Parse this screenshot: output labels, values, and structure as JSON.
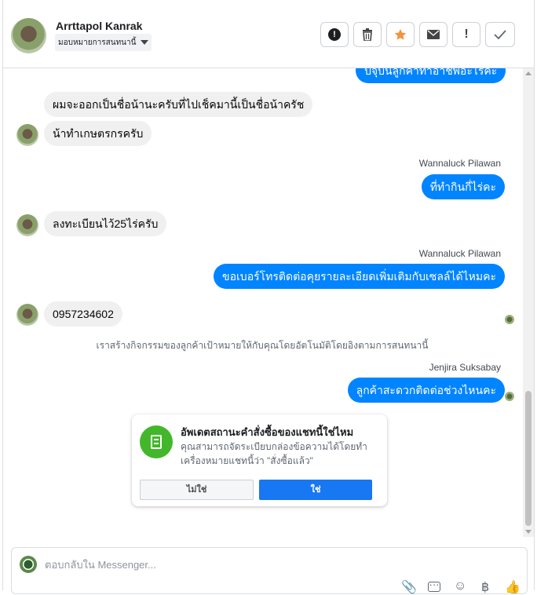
{
  "header": {
    "contact_name": "Arrttapol Kanrak",
    "assign_label": "มอบหมายการสนทนานี้",
    "tools": [
      {
        "icon": "alert-circle-icon",
        "glyph": "❗"
      },
      {
        "icon": "trash-icon",
        "glyph": "🗑"
      },
      {
        "icon": "star-icon",
        "glyph": "★"
      },
      {
        "icon": "envelope-icon",
        "glyph": "✉"
      },
      {
        "icon": "exclamation-icon",
        "glyph": "!"
      },
      {
        "icon": "check-icon",
        "glyph": "✓"
      }
    ]
  },
  "thread": {
    "partial_top": "ปัจุบันลูกค้าทำอาชีพอะไรคะ",
    "m1": "ผมจะออกเป็นชื่อน้านะครับที่ไปเช็คมานี้เป็นชื่อน้าครัช",
    "m2": "น้าทำเกษตรกรครับ",
    "s1": "Wannaluck Pilawan",
    "m3": "ที่ทำกินกี่ไร่คะ",
    "m4": "ลงทะเบียนไว้25ไร่ครับ",
    "s2": "Wannaluck Pilawan",
    "m5": "ขอเบอร์โทรติดต่อคุยรายละเอียดเพิ่มเติมกับเซลล์ได้ไหมคะ",
    "m6": "0957234602",
    "system_note": "เราสร้างกิจกรรมของลูกค้าเป้าหมายให้กับคุณโดยอัตโนมัติโดยอิงตามการสนทนานี้",
    "s3": "Jenjira Suksabay",
    "m7": "ลูกค้าสะดวกติดต่อช่วงไหนคะ"
  },
  "card": {
    "title": "อัพเดตสถานะคำสั่งซื้อของแชทนี้ใช่ไหม",
    "body": "คุณสามารถจัดระเบียบกล่องข้อความได้โดยทำเครื่องหมายแชทนี้ว่า \"สั่งซื้อแล้ว\"",
    "no_label": "ไม่ใช่",
    "yes_label": "ใช่"
  },
  "composer": {
    "placeholder": "ตอบกลับใน Messenger...",
    "tools": [
      "paperclip-icon",
      "saved-reply-icon",
      "emoji-icon",
      "baht-icon",
      "like-icon"
    ]
  },
  "colors": {
    "outgoing": "#0084ff",
    "incoming": "#f0f0f0",
    "primary_button": "#1877f2",
    "card_icon": "#42b72a"
  }
}
